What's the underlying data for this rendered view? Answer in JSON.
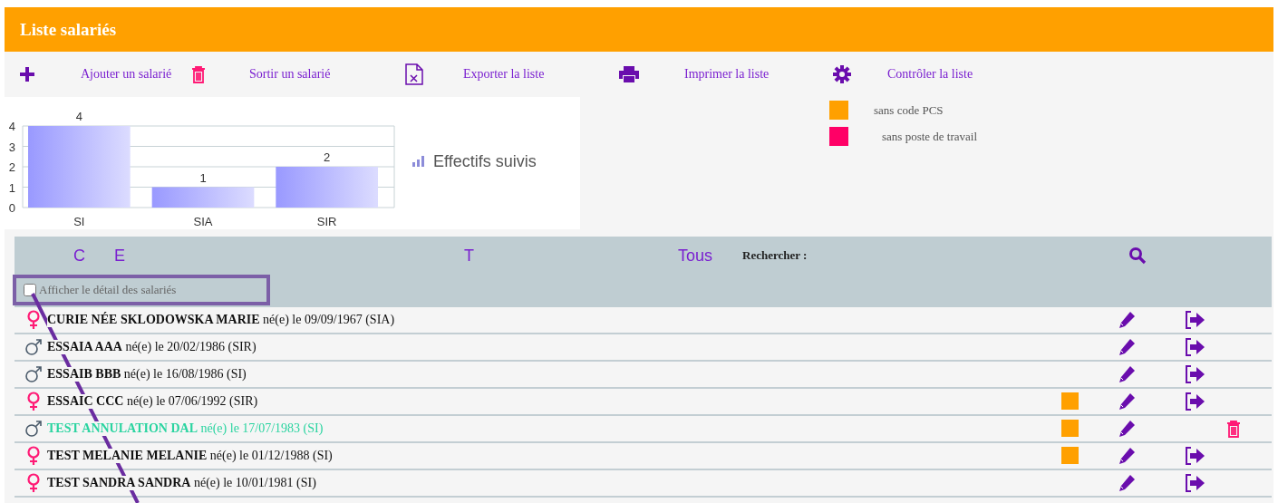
{
  "window": {
    "title": "Liste salariés"
  },
  "toolbar": [
    {
      "kind": "add",
      "label": "Ajouter un salarié"
    },
    {
      "kind": "remove",
      "label": "Sortir un salarié"
    },
    {
      "kind": "export",
      "label": "Exporter la liste"
    },
    {
      "kind": "print",
      "label": "Imprimer la liste"
    },
    {
      "kind": "check",
      "label": "Contrôler la liste"
    }
  ],
  "chart": {
    "legend": "Effectifs suivis",
    "chart_data": {
      "type": "bar",
      "categories": [
        "SI",
        "SIA",
        "SIR"
      ],
      "values": [
        4,
        1,
        2
      ],
      "yticks": [
        0,
        1,
        2,
        3,
        4
      ],
      "ylim": [
        0,
        4
      ],
      "grid": true,
      "data_labels": true
    }
  },
  "legend": [
    {
      "label": "sans code PCS",
      "color": "#ffa000"
    },
    {
      "label": "sans poste de travail",
      "color": "#ff0066"
    }
  ],
  "table_header": {
    "column_1": "C",
    "column_2": "E",
    "column_3": "T",
    "filter": "Tous",
    "search_label": "Rechercher :",
    "detail_checkbox": {
      "label": "Afficher le détail des salariés",
      "checked": false
    }
  },
  "rows": [
    {
      "kind": "female",
      "name": "CURIE NÉE SKLODOWSKA MARIE",
      "details": "né(e) le 09/09/1967 (SIA)",
      "cancelled": false,
      "missing_pcs": false
    },
    {
      "kind": "male",
      "name": "ESSAIA AAA",
      "details": "né(e) le 20/02/1986 (SIR)",
      "cancelled": false,
      "missing_pcs": false
    },
    {
      "kind": "male",
      "name": "ESSAIB BBB",
      "details": "né(e) le 16/08/1986 (SI)",
      "cancelled": false,
      "missing_pcs": false
    },
    {
      "kind": "female",
      "name": "ESSAIC CCC",
      "details": "né(e) le 07/06/1992 (SIR)",
      "cancelled": false,
      "missing_pcs": true
    },
    {
      "kind": "male",
      "name": "TEST ANNULATION DAL",
      "details": "né(e) le 17/07/1983 (SI)",
      "cancelled": true,
      "missing_pcs": true
    },
    {
      "kind": "female",
      "name": "TEST MELANIE MELANIE",
      "details": "né(e) le 01/12/1988 (SI)",
      "cancelled": false,
      "missing_pcs": true
    },
    {
      "kind": "female",
      "name": "TEST SANDRA SANDRA",
      "details": "né(e) le 10/01/1981 (SI)",
      "cancelled": false,
      "missing_pcs": false
    }
  ]
}
